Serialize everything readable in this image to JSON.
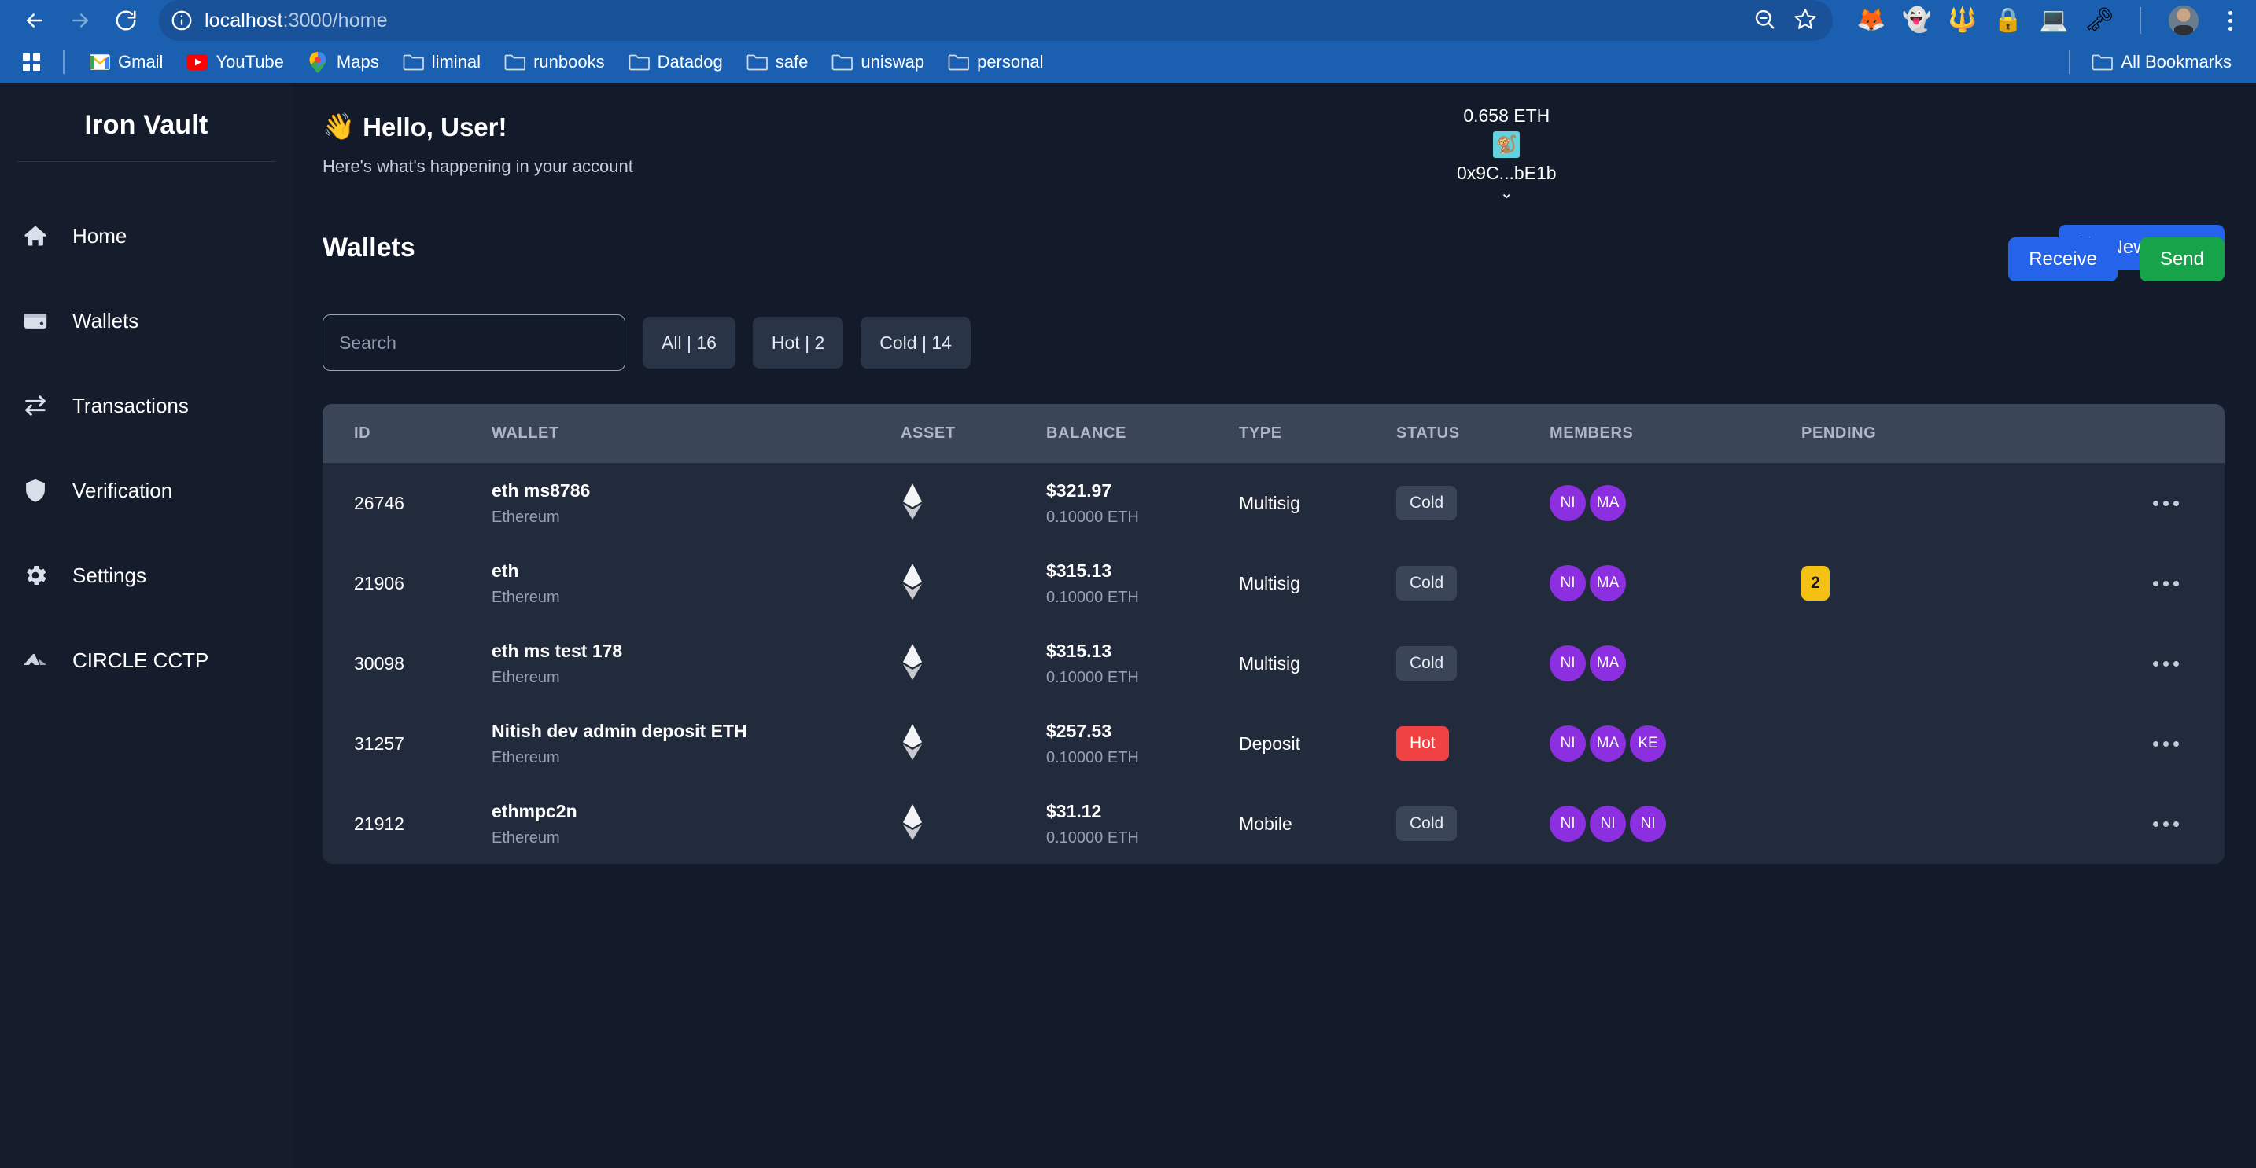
{
  "browser": {
    "url_main": "localhost",
    "url_rest": ":3000/home",
    "back_icon": "back-arrow-icon",
    "forward_icon": "forward-arrow-icon",
    "reload_icon": "reload-icon",
    "site_info_icon": "site-info-icon",
    "zoom_out_icon": "zoom-out-icon",
    "bookmark_star_icon": "star-icon",
    "extensions": [
      {
        "name": "metamask-extension-icon",
        "glyph": "🦊"
      },
      {
        "name": "phantom-extension-icon",
        "glyph": "👻"
      },
      {
        "name": "keplr-extension-icon",
        "glyph": "🔱"
      },
      {
        "name": "privacy-extension-icon",
        "glyph": "🔒"
      },
      {
        "name": "ledger-extension-icon",
        "glyph": "💻"
      },
      {
        "name": "keystore-extension-icon",
        "glyph": "🗝"
      }
    ],
    "profile_avatar": "profile-avatar",
    "menu_icon": "chrome-menu-icon",
    "bookmarks": [
      {
        "label": "Gmail",
        "icon": "gmail-icon"
      },
      {
        "label": "YouTube",
        "icon": "youtube-icon"
      },
      {
        "label": "Maps",
        "icon": "maps-icon"
      },
      {
        "label": "liminal",
        "icon": "folder-icon"
      },
      {
        "label": "runbooks",
        "icon": "folder-icon"
      },
      {
        "label": "Datadog",
        "icon": "folder-icon"
      },
      {
        "label": "safe",
        "icon": "folder-icon"
      },
      {
        "label": "uniswap",
        "icon": "folder-icon"
      },
      {
        "label": "personal",
        "icon": "folder-icon"
      }
    ],
    "all_bookmarks_label": "All Bookmarks"
  },
  "sidebar": {
    "brand": "Iron Vault",
    "items": [
      {
        "label": "Home",
        "icon": "home-icon"
      },
      {
        "label": "Wallets",
        "icon": "wallet-icon"
      },
      {
        "label": "Transactions",
        "icon": "transactions-arrows-icon"
      },
      {
        "label": "Verification",
        "icon": "shield-icon"
      },
      {
        "label": "Settings",
        "icon": "gear-icon"
      },
      {
        "label": "CIRCLE CCTP",
        "icon": "circle-cctp-icon"
      }
    ]
  },
  "header": {
    "greeting_emoji": "👋",
    "greeting": "Hello, User!",
    "subtitle": "Here's what's happening in your account",
    "wallet_balance": "0.658 ETH",
    "wallet_avatar_glyph": "🐒",
    "wallet_address": "0x9C...bE1b",
    "chevron": "⌄",
    "receive_label": "Receive",
    "send_label": "Send"
  },
  "wallets_panel": {
    "title": "Wallets",
    "new_wallet_label": "New Wallet",
    "new_wallet_icon": "fuel-pump-icon",
    "search_placeholder": "Search",
    "search_value": "",
    "filters": [
      {
        "label": "All | 16"
      },
      {
        "label": "Hot | 2"
      },
      {
        "label": "Cold | 14"
      }
    ],
    "columns": [
      "ID",
      "WALLET",
      "ASSET",
      "BALANCE",
      "TYPE",
      "STATUS",
      "MEMBERS",
      "PENDING",
      ""
    ],
    "rows": [
      {
        "id": "26746",
        "name": "eth ms8786",
        "chain": "Ethereum",
        "asset_icon": "ethereum-icon",
        "balance_usd": "$321.97",
        "balance_native": "0.10000 ETH",
        "type": "Multisig",
        "status": "Cold",
        "members": [
          "NI",
          "MA"
        ],
        "pending": ""
      },
      {
        "id": "21906",
        "name": "eth",
        "chain": "Ethereum",
        "asset_icon": "ethereum-icon",
        "balance_usd": "$315.13",
        "balance_native": "0.10000 ETH",
        "type": "Multisig",
        "status": "Cold",
        "members": [
          "NI",
          "MA"
        ],
        "pending": "2"
      },
      {
        "id": "30098",
        "name": "eth ms test 178",
        "chain": "Ethereum",
        "asset_icon": "ethereum-icon",
        "balance_usd": "$315.13",
        "balance_native": "0.10000 ETH",
        "type": "Multisig",
        "status": "Cold",
        "members": [
          "NI",
          "MA"
        ],
        "pending": ""
      },
      {
        "id": "31257",
        "name": "Nitish dev admin deposit ETH",
        "chain": "Ethereum",
        "asset_icon": "ethereum-icon",
        "balance_usd": "$257.53",
        "balance_native": "0.10000 ETH",
        "type": "Deposit",
        "status": "Hot",
        "members": [
          "NI",
          "MA",
          "KE"
        ],
        "pending": ""
      },
      {
        "id": "21912",
        "name": "ethmpc2n",
        "chain": "Ethereum",
        "asset_icon": "ethereum-icon",
        "balance_usd": "$31.12",
        "balance_native": "0.10000 ETH",
        "type": "Mobile",
        "status": "Cold",
        "members": [
          "NI",
          "NI",
          "NI"
        ],
        "pending": ""
      }
    ],
    "row_actions_icon": "more-options-icon"
  },
  "colors": {
    "page_bg": "#131a2a",
    "sidebar_bg": "#151c2c",
    "table_bg": "#222b3c",
    "table_head_bg": "#3a4557",
    "accent_blue": "#2563eb",
    "accent_green": "#16a34a",
    "hot_red": "#f04242",
    "pending_yellow": "#f5c014",
    "member_purple": "#8b2fe0",
    "browser_blue": "#1b5fb0"
  }
}
